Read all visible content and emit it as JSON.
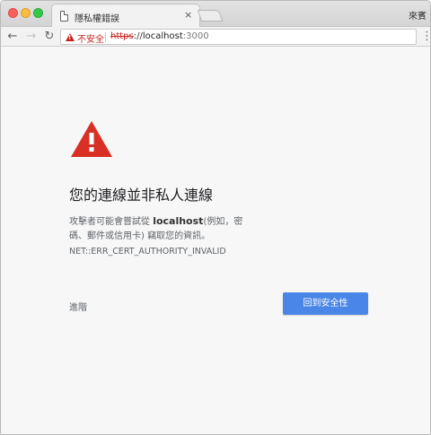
{
  "tab": {
    "title": "隱私權錯誤",
    "close": "×"
  },
  "profile": "來賓",
  "toolbar": {
    "back": "←",
    "forward": "→",
    "reload": "↻",
    "menu": "⋮"
  },
  "omnibox": {
    "security_label": "不安全",
    "url_scheme": "https",
    "url_sep": "://",
    "url_host": "localhost",
    "url_port": ":3000"
  },
  "interstitial": {
    "heading": "您的連線並非私人連線",
    "desc_before": "攻擊者可能會嘗試從 ",
    "desc_host": "localhost",
    "desc_after": "(例如，密碼、郵件或信用卡) 竊取您的資訊。",
    "error_code": "NET::ERR_CERT_AUTHORITY_INVALID",
    "advanced": "進階",
    "back_button": "回到安全性"
  },
  "colors": {
    "warning_red": "#d93025",
    "button_blue": "#4a86e8"
  }
}
